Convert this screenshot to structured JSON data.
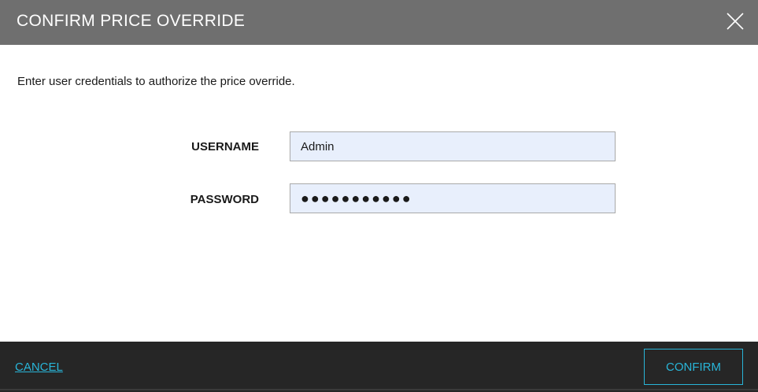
{
  "dialog": {
    "title": "CONFIRM PRICE OVERRIDE",
    "close_icon": "close-icon"
  },
  "body": {
    "instruction": "Enter user credentials to authorize the price override.",
    "username": {
      "label": "USERNAME",
      "value": "Admin"
    },
    "password": {
      "label": "PASSWORD",
      "value": "●●●●●●●●●●●"
    }
  },
  "footer": {
    "cancel_label": "CANCEL",
    "confirm_label": "CONFIRM"
  },
  "colors": {
    "title_bar": "#6f6f6f",
    "footer": "#262626",
    "accent": "#29b5d8",
    "input_bg": "#e8effc"
  }
}
